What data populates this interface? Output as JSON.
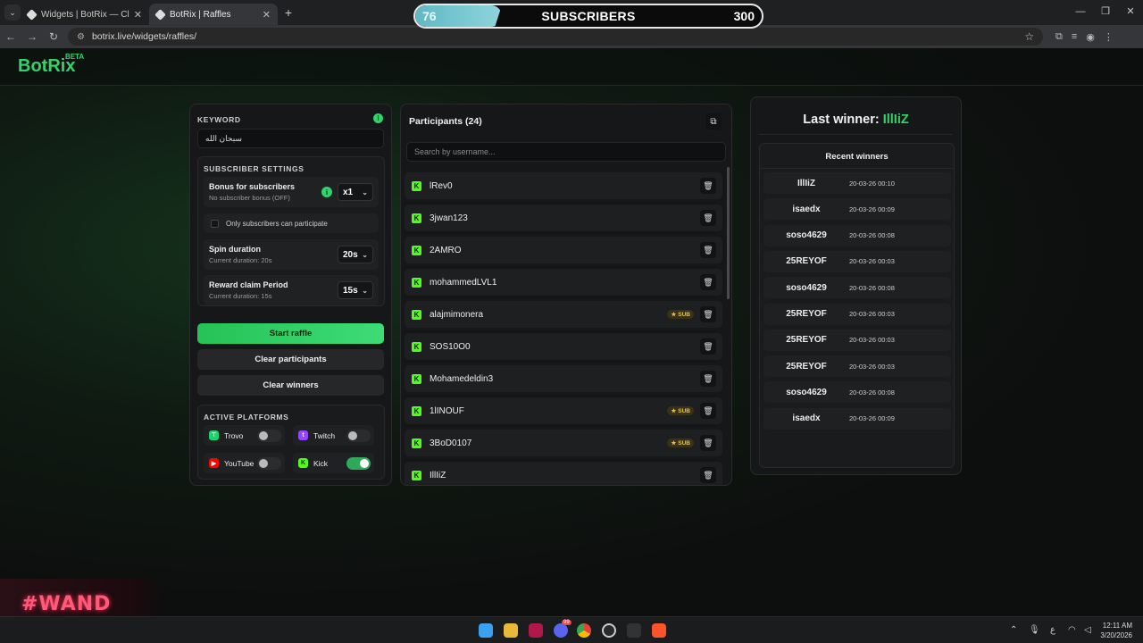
{
  "browser": {
    "tabs": [
      {
        "title": "Widgets | BotRix — Cloud Strea"
      },
      {
        "title": "BotRix | Raffles"
      }
    ],
    "url": "botrix.live/widgets/raffles/"
  },
  "subscribers": {
    "current": "76",
    "label": "SUBSCRIBERS",
    "goal": "300",
    "progress": 0.25
  },
  "site": {
    "logo": "BotRix",
    "logo_tag": "BETA"
  },
  "settings": {
    "keyword_title": "KEYWORD",
    "keyword_value": "سبحان الله",
    "subscriber_title": "SUBSCRIBER SETTINGS",
    "bonus_label": "Bonus for subscribers",
    "bonus_sub": "No subscriber bonus (OFF)",
    "bonus_value": "x1",
    "only_subs_label": "Only subscribers can participate",
    "spin_label": "Spin duration",
    "spin_sub": "Current duration: 20s",
    "spin_value": "20s",
    "claim_label": "Reward claim Period",
    "claim_sub": "Current duration: 15s",
    "claim_value": "15s",
    "start_button": "Start raffle",
    "clear_participants_button": "Clear participants",
    "clear_winners_button": "Clear winners",
    "platforms_title": "ACTIVE PLATFORMS",
    "platforms": [
      {
        "name": "Trovo",
        "on": false,
        "color": "#19d66b"
      },
      {
        "name": "Twitch",
        "on": false,
        "color": "#9146ff"
      },
      {
        "name": "YouTube",
        "on": false,
        "color": "#ff0000"
      },
      {
        "name": "Kick",
        "on": true,
        "color": "#53fc18"
      }
    ]
  },
  "participants": {
    "title": "Participants (24)",
    "search_placeholder": "Search by username...",
    "sub_badge": "SUB",
    "list": [
      {
        "name": "lRev0",
        "sub": false
      },
      {
        "name": "3jwan123",
        "sub": false
      },
      {
        "name": "2AMRO",
        "sub": false
      },
      {
        "name": "mohammedLVL1",
        "sub": false
      },
      {
        "name": "alajmimonera",
        "sub": true
      },
      {
        "name": "SOS10O0",
        "sub": false
      },
      {
        "name": "Mohamedeldin3",
        "sub": false
      },
      {
        "name": "1lINOUF",
        "sub": true
      },
      {
        "name": "3BoD0107",
        "sub": true
      },
      {
        "name": "IllIiZ",
        "sub": false
      }
    ]
  },
  "winners": {
    "last_winner_label": "Last winner:",
    "last_winner_name": "IllIiZ",
    "recent_title": "Recent winners",
    "list": [
      {
        "name": "IllIiZ",
        "date": "20-03-26 00:10"
      },
      {
        "name": "isaedx",
        "date": "20-03-26 00:09"
      },
      {
        "name": "soso4629",
        "date": "20-03-26 00:08"
      },
      {
        "name": "25REYOF",
        "date": "20-03-26 00:03"
      },
      {
        "name": "soso4629",
        "date": "20-03-26 00:08"
      },
      {
        "name": "25REYOF",
        "date": "20-03-26 00:03"
      },
      {
        "name": "25REYOF",
        "date": "20-03-26 00:03"
      },
      {
        "name": "25REYOF",
        "date": "20-03-26 00:03"
      },
      {
        "name": "soso4629",
        "date": "20-03-26 00:08"
      },
      {
        "name": "isaedx",
        "date": "20-03-26 00:09"
      }
    ]
  },
  "overlay_banner": "#WAND",
  "taskbar": {
    "time": "12:11 AM",
    "date": "3/20/2026",
    "lang": "ع",
    "discord_badge": "99"
  }
}
